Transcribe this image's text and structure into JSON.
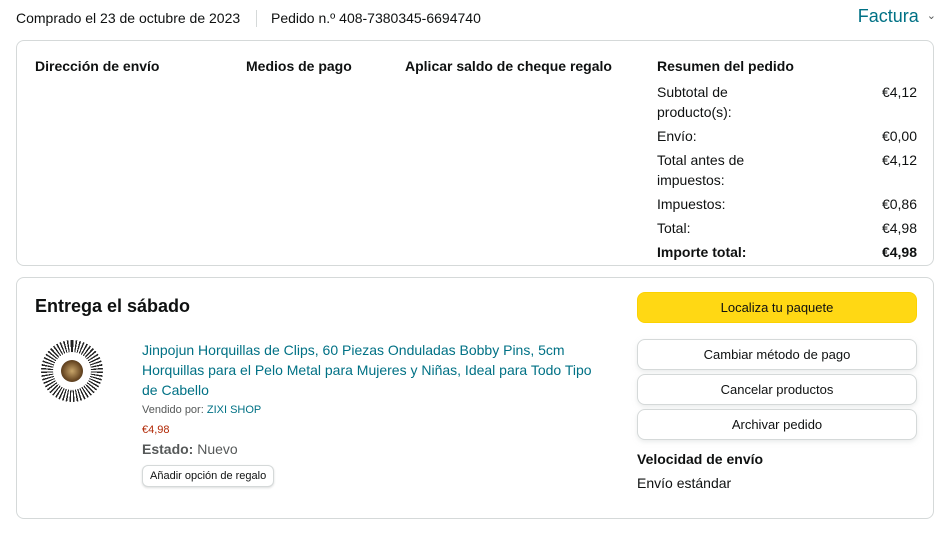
{
  "header": {
    "purchase_date": "Comprado el 23 de octubre de 2023",
    "order_number": "Pedido n.º 408-7380345-6694740",
    "invoice_label": "Factura",
    "invoice_chevron": "⌄"
  },
  "summary_card": {
    "shipping_address_heading": "Dirección de envío",
    "payment_methods_heading": "Medios de pago",
    "gift_card_heading": "Aplicar saldo de cheque regalo",
    "order_summary": {
      "heading": "Resumen del pedido",
      "rows": [
        {
          "label": "Subtotal de producto(s):",
          "value": "€4,12"
        },
        {
          "label": "Envío:",
          "value": "€0,00"
        },
        {
          "label": "Total antes de impuestos:",
          "value": "€4,12"
        },
        {
          "label": "Impuestos:",
          "value": "€0,86"
        },
        {
          "label": "Total:",
          "value": "€4,98"
        }
      ],
      "grand_total_label": "Importe total:",
      "grand_total_value": "€4,98"
    }
  },
  "delivery_card": {
    "title": "Entrega el sábado",
    "product": {
      "image_icon": "hairpins-product-image",
      "title": "Jinpojun Horquillas de Clips, 60 Piezas Onduladas Bobby Pins, 5cm Horquillas para el Pelo Metal para Mujeres y Niñas, Ideal para Todo Tipo de Cabello",
      "sold_by_label": "Vendido por: ",
      "seller": "ZIXI SHOP",
      "price": "€4,98",
      "state_label": "Estado: ",
      "state_value": "Nuevo",
      "gift_option_label": "Añadir opción de regalo"
    },
    "actions": {
      "track_package": "Localiza tu paquete",
      "change_payment": "Cambiar método de pago",
      "cancel_items": "Cancelar productos",
      "archive_order": "Archivar pedido"
    },
    "shipping_speed_label": "Velocidad de envío",
    "shipping_speed_value": "Envío estándar"
  },
  "colors": {
    "link": "#007185",
    "primary_button": "#ffd814",
    "price": "#b12704",
    "border": "#d5d9d9"
  }
}
